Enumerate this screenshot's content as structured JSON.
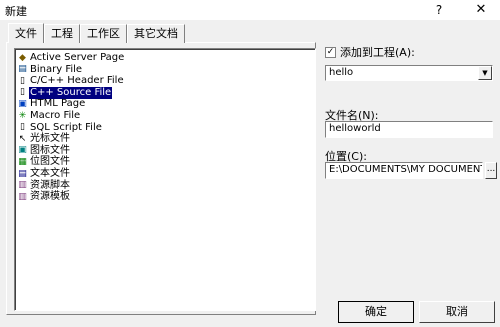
{
  "window": {
    "title": "新建",
    "help_label": "?",
    "close_label": "✕"
  },
  "tabs": [
    {
      "label": "文件"
    },
    {
      "label": "工程"
    },
    {
      "label": "工作区"
    },
    {
      "label": "其它文档"
    }
  ],
  "file_types": [
    {
      "label": "Active Server Page",
      "icon": "asp-file-icon",
      "selected": false
    },
    {
      "label": "Binary File",
      "icon": "binary-file-icon",
      "selected": false
    },
    {
      "label": "C/C++ Header File",
      "icon": "header-file-icon",
      "selected": false
    },
    {
      "label": "C++ Source File",
      "icon": "cpp-source-file-icon",
      "selected": true
    },
    {
      "label": "HTML Page",
      "icon": "html-page-icon",
      "selected": false
    },
    {
      "label": "Macro File",
      "icon": "macro-file-icon",
      "selected": false
    },
    {
      "label": "SQL Script File",
      "icon": "sql-script-file-icon",
      "selected": false
    },
    {
      "label": "光标文件",
      "icon": "cursor-file-icon",
      "selected": false
    },
    {
      "label": "图标文件",
      "icon": "icon-file-icon",
      "selected": false
    },
    {
      "label": "位图文件",
      "icon": "bitmap-file-icon",
      "selected": false
    },
    {
      "label": "文本文件",
      "icon": "text-file-icon",
      "selected": false
    },
    {
      "label": "资源脚本",
      "icon": "resource-script-icon",
      "selected": false
    },
    {
      "label": "资源模板",
      "icon": "resource-template-icon",
      "selected": false
    }
  ],
  "add_to_project": {
    "label": "添加到工程(A):",
    "checked": true,
    "check_mark": "✓",
    "project": "hello"
  },
  "file_name": {
    "label": "文件名(N):",
    "value": "helloworld"
  },
  "location": {
    "label": "位置(C):",
    "value": "E:\\DOCUMENTS\\MY DOCUMENT",
    "browse_label": "..."
  },
  "buttons": {
    "ok": "确定",
    "cancel": "取消"
  },
  "colors": {
    "selection": "#000080",
    "dialog_bg": "#f0f0f0"
  }
}
